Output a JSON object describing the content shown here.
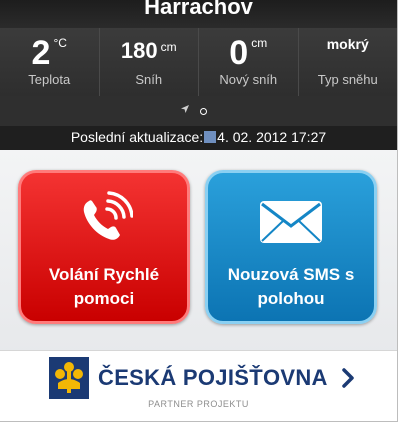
{
  "header": {
    "title": "Harrachov"
  },
  "stats": [
    {
      "value": "2",
      "unit": "°C",
      "label": "Teplota"
    },
    {
      "value": "180",
      "unit": "cm",
      "label": "Sníh"
    },
    {
      "value": "0",
      "unit": "cm",
      "label": "Nový sníh"
    },
    {
      "value": "mokrý",
      "unit": "",
      "label": "Typ sněhu"
    }
  ],
  "update": {
    "prefix": "Poslední aktualizace:",
    "value": "4. 02. 2012 17:27"
  },
  "actions": {
    "call": {
      "line1": "Volání Rychlé",
      "line2": "pomoci"
    },
    "sms": {
      "line1": "Nouzová SMS s",
      "line2": "polohou"
    }
  },
  "partner": {
    "brand": "ČESKÁ POJIŠŤOVNA",
    "subtitle": "PARTNER PROJEKTU"
  },
  "colors": {
    "red": "#d90505",
    "blue": "#1486c6",
    "brand_blue": "#1b3a74",
    "logo_yellow": "#f2b705"
  },
  "icons": [
    "location-arrow-icon",
    "page-dot-icon",
    "phone-icon",
    "envelope-icon",
    "ceska-pojistovna-logo-icon",
    "chevron-right-icon"
  ]
}
